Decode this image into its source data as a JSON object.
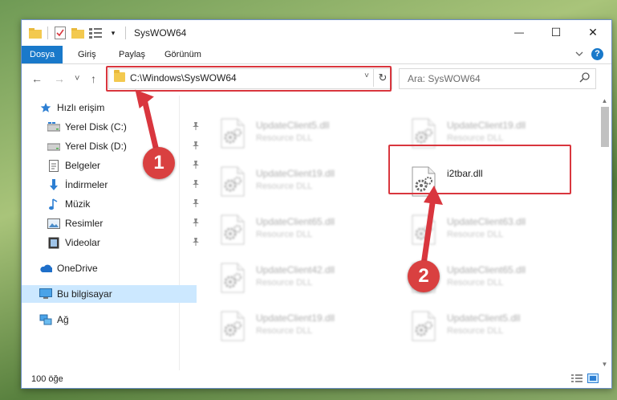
{
  "window": {
    "title": "SysWOW64",
    "controls": {
      "minimize": "—",
      "maximize": "☐",
      "close": "✕"
    }
  },
  "ribbon": {
    "tabs": [
      "Dosya",
      "Giriş",
      "Paylaş",
      "Görünüm"
    ],
    "active_tab": "Dosya",
    "help": "?"
  },
  "navigation": {
    "back": "←",
    "forward": "→",
    "recent": "˅",
    "up": "↑",
    "address": "C:\\Windows\\SysWOW64",
    "address_dropdown": "˅",
    "refresh": "↻",
    "search_placeholder": "Ara: SysWOW64"
  },
  "sidebar": {
    "items": [
      {
        "label": "Hızlı erişim",
        "icon": "star-icon",
        "pinned": false
      },
      {
        "label": "Yerel Disk (C:)",
        "icon": "drive-icon",
        "pinned": true
      },
      {
        "label": "Yerel Disk (D:)",
        "icon": "drive-icon",
        "pinned": true
      },
      {
        "label": "Belgeler",
        "icon": "document-icon",
        "pinned": true
      },
      {
        "label": "İndirmeler",
        "icon": "download-icon",
        "pinned": true
      },
      {
        "label": "Müzik",
        "icon": "music-icon",
        "pinned": true
      },
      {
        "label": "Resimler",
        "icon": "picture-icon",
        "pinned": true
      },
      {
        "label": "Videolar",
        "icon": "video-icon",
        "pinned": true
      },
      {
        "label": "OneDrive",
        "icon": "cloud-icon",
        "pinned": false
      },
      {
        "label": "Bu bilgisayar",
        "icon": "computer-icon",
        "pinned": false,
        "selected": true
      },
      {
        "label": "Ağ",
        "icon": "network-icon",
        "pinned": false
      }
    ]
  },
  "files": [
    {
      "name": "UpdateClient5.dll",
      "type": "Resource DLL",
      "blurred": true
    },
    {
      "name": "UpdateClient19.dll",
      "type": "Resource DLL",
      "blurred": true
    },
    {
      "name": "UpdateClient19.dll",
      "type": "Resource DLL",
      "blurred": true
    },
    {
      "name": "i2tbar.dll",
      "type": "",
      "blurred": false
    },
    {
      "name": "UpdateClient65.dll",
      "type": "Resource DLL",
      "blurred": true
    },
    {
      "name": "UpdateClient63.dll",
      "type": "Resource DLL",
      "blurred": true
    },
    {
      "name": "UpdateClient42.dll",
      "type": "Resource DLL",
      "blurred": true
    },
    {
      "name": "UpdateClient65.dll",
      "type": "Resource DLL",
      "blurred": true
    },
    {
      "name": "UpdateClient19.dll",
      "type": "Resource DLL",
      "blurred": true
    },
    {
      "name": "UpdateClient5.dll",
      "type": "Resource DLL",
      "blurred": true
    }
  ],
  "status": {
    "item_count": "100 öğe"
  },
  "annotations": {
    "step1": "1",
    "step2": "2",
    "color": "#d9363e"
  }
}
